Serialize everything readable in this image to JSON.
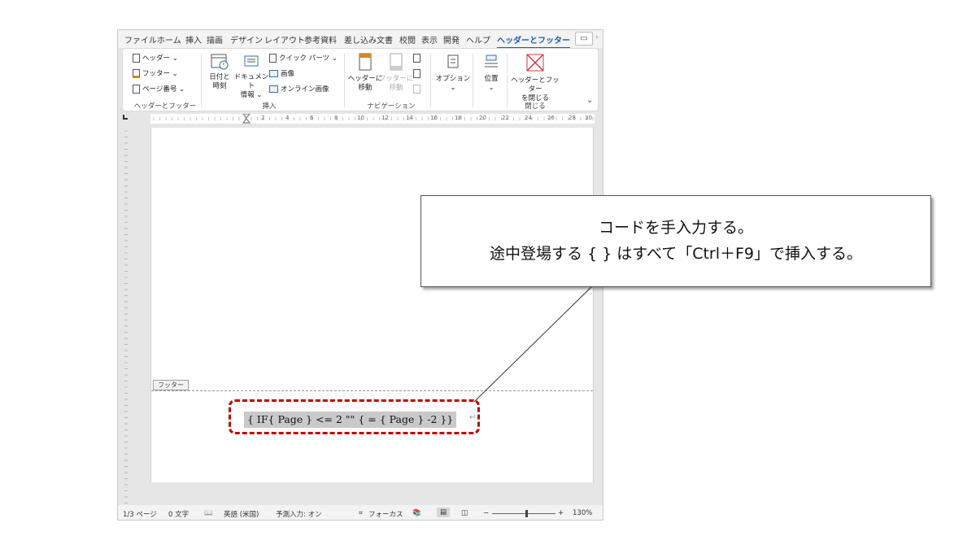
{
  "tabs": [
    "ファイル",
    "ホーム",
    "挿入",
    "描画",
    "デザイン",
    "レイアウト",
    "参考資料",
    "差し込み文書",
    "校閲",
    "表示",
    "開発",
    "ヘルプ",
    "ヘッダーとフッター"
  ],
  "ribbon": {
    "header_footer": {
      "header": "ヘッダー ⌄",
      "footer": "フッター ⌄",
      "page_number": "ページ番号 ⌄",
      "label": "ヘッダーとフッター"
    },
    "insert": {
      "datetime_1": "日付と",
      "datetime_2": "時刻",
      "docinfo_1": "ドキュメント",
      "docinfo_2": "情報 ⌄",
      "quickparts": "クイック パーツ ⌄",
      "picture": "画像",
      "online_picture": "オンライン画像",
      "label": "挿入"
    },
    "navigation": {
      "goto_header_1": "ヘッダーに",
      "goto_header_2": "移動",
      "goto_footer_1": "フッターに",
      "goto_footer_2": "移動",
      "label": "ナビゲーション"
    },
    "options": {
      "options": "オプション",
      "position": "位置",
      "chevron": "⌄"
    },
    "close": {
      "close_1": "ヘッダーとフッター",
      "close_2": "を閉じる",
      "label": "閉じる"
    }
  },
  "ruler_numbers": [
    "2",
    "4",
    "6",
    "8",
    "10",
    "12",
    "14",
    "16",
    "18",
    "20",
    "22",
    "24",
    "26",
    "28",
    "30"
  ],
  "document": {
    "footer_tag": "フッター",
    "field_code": "{ IF{ Page } <= 2 \"\" { = { Page } -2 }}",
    "para_mark": "↵"
  },
  "status": {
    "page": "1/3 ページ",
    "words": "0 文字",
    "language": "英語 (米国)",
    "predict": "予測入力: オン",
    "focus": "フォーカス",
    "zoom_minus": "−",
    "zoom_plus": "+",
    "zoom": "130%",
    "zoom_percent": 130
  },
  "callout": {
    "line1": "コードを手入力する。",
    "line2": "途中登場する { } はすべて「Ctrl＋F9」で挿入する。"
  },
  "colors": {
    "accent": "#1f5aa6",
    "highlight": "#c00000",
    "field_bg": "#c9c9c9"
  }
}
